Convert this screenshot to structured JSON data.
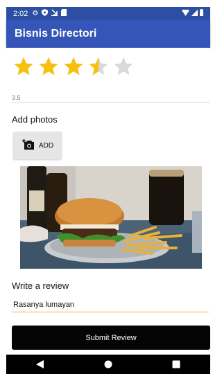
{
  "status_bar": {
    "time": "2:02",
    "icons": [
      "settings-gear-icon",
      "shield-icon",
      "download-icon",
      "sd-card-icon"
    ],
    "right_icons": [
      "wifi-icon",
      "signal-icon",
      "battery-icon"
    ]
  },
  "app_bar": {
    "title": "Bisnis Directori",
    "color": "#3556b8"
  },
  "rating": {
    "stars_total": 5,
    "value_display": "3.5",
    "value": 3.5,
    "star_color": "#f6c00e",
    "empty_color": "#d9d9d9"
  },
  "photos": {
    "label": "Add photos",
    "add_button_label": "ADD",
    "add_icon": "add-photo-camera-icon"
  },
  "review": {
    "label": "Write a review",
    "input_value": "Rasanya lumayan",
    "underline_color": "#e3b82b"
  },
  "submit": {
    "label": "Submit Review"
  },
  "nav_bar": {
    "buttons": [
      "back-icon",
      "home-icon",
      "recents-icon"
    ]
  }
}
